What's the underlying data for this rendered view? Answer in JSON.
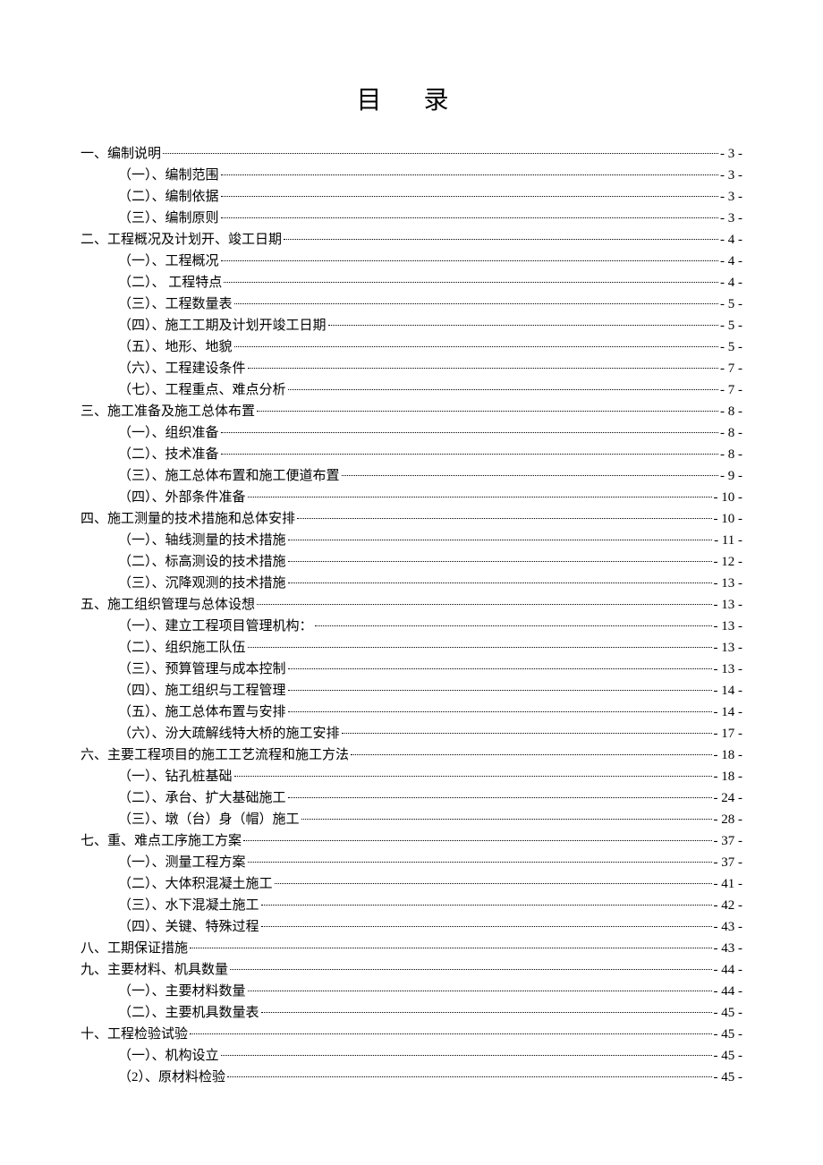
{
  "title": "目 录",
  "entries": [
    {
      "level": 1,
      "label": "一、编制说明",
      "page": "- 3 -"
    },
    {
      "level": 2,
      "label": "（一）、编制范围",
      "page": "- 3 -"
    },
    {
      "level": 2,
      "label": "（二）、编制依据",
      "page": "- 3 -"
    },
    {
      "level": 2,
      "label": "（三）、编制原则",
      "page": "- 3 -"
    },
    {
      "level": 1,
      "label": "二、工程概况及计划开、竣工日期",
      "page": "- 4 -"
    },
    {
      "level": 2,
      "label": "（一）、工程概况",
      "page": "- 4 -"
    },
    {
      "level": 2,
      "label": "（二）、 工程特点",
      "page": "- 4 -"
    },
    {
      "level": 2,
      "label": "（三）、工程数量表",
      "page": "- 5 -"
    },
    {
      "level": 2,
      "label": "（四）、施工工期及计划开竣工日期",
      "page": "- 5 -"
    },
    {
      "level": 2,
      "label": "（五）、地形、地貌",
      "page": "- 5 -"
    },
    {
      "level": 2,
      "label": "（六）、工程建设条件",
      "page": "- 7 -"
    },
    {
      "level": 2,
      "label": "（七）、工程重点、难点分析",
      "page": "- 7 -"
    },
    {
      "level": 1,
      "label": "三、施工准备及施工总体布置",
      "page": "- 8 -"
    },
    {
      "level": 2,
      "label": "（一）、组织准备",
      "page": "- 8 -"
    },
    {
      "level": 2,
      "label": "（二）、技术准备",
      "page": "- 8 -"
    },
    {
      "level": 2,
      "label": "（三）、施工总体布置和施工便道布置",
      "page": "- 9 -"
    },
    {
      "level": 2,
      "label": "（四）、外部条件准备",
      "page": "- 10 -"
    },
    {
      "level": 1,
      "label": "四、施工测量的技术措施和总体安排",
      "page": "- 10 -"
    },
    {
      "level": 2,
      "label": "（一）、轴线测量的技术措施",
      "page": "- 11 -"
    },
    {
      "level": 2,
      "label": "（二）、标高测设的技术措施",
      "page": "- 12 -"
    },
    {
      "level": 2,
      "label": "（三）、沉降观测的技术措施",
      "page": "- 13 -"
    },
    {
      "level": 1,
      "label": "五、施工组织管理与总体设想",
      "page": "- 13 -"
    },
    {
      "level": 2,
      "label": "（一）、建立工程项目管理机构：",
      "page": "- 13 -"
    },
    {
      "level": 2,
      "label": "（二）、组织施工队伍",
      "page": "- 13 -"
    },
    {
      "level": 2,
      "label": "（三）、预算管理与成本控制",
      "page": "- 13 -"
    },
    {
      "level": 2,
      "label": "（四）、施工组织与工程管理",
      "page": "- 14 -"
    },
    {
      "level": 2,
      "label": "（五）、施工总体布置与安排",
      "page": "- 14 -"
    },
    {
      "level": 2,
      "label": "（六）、汾大疏解线特大桥的施工安排",
      "page": "- 17 -"
    },
    {
      "level": 1,
      "label": "六、主要工程项目的施工工艺流程和施工方法",
      "page": "- 18 -"
    },
    {
      "level": 2,
      "label": "（一）、钻孔桩基础",
      "page": "- 18 -"
    },
    {
      "level": 2,
      "label": "（二）、承台、扩大基础施工",
      "page": "- 24 -"
    },
    {
      "level": 2,
      "label": "（三）、墩（台）身（帽）施工",
      "page": "- 28 -"
    },
    {
      "level": 1,
      "label": "七、重、难点工序施工方案",
      "page": "- 37 -"
    },
    {
      "level": 2,
      "label": "（一）、测量工程方案",
      "page": "- 37 -"
    },
    {
      "level": 2,
      "label": "（二）、大体积混凝土施工",
      "page": "- 41 -"
    },
    {
      "level": 2,
      "label": "（三）、水下混凝土施工",
      "page": "- 42 -"
    },
    {
      "level": 2,
      "label": "（四）、关键、特殊过程",
      "page": "- 43 -"
    },
    {
      "level": 1,
      "label": "八、工期保证措施",
      "page": "- 43 -"
    },
    {
      "level": 1,
      "label": "九、主要材料、机具数量",
      "page": "- 44 -"
    },
    {
      "level": 2,
      "label": "（一）、主要材料数量",
      "page": "- 44 -"
    },
    {
      "level": 2,
      "label": "（二）、主要机具数量表",
      "page": "- 45 -"
    },
    {
      "level": 1,
      "label": "十、工程检验试验",
      "page": "- 45 -"
    },
    {
      "level": 2,
      "label": "（一）、机构设立",
      "page": "- 45 -"
    },
    {
      "level": 2,
      "label": "（2）、原材料检验",
      "page": "- 45 -"
    }
  ]
}
